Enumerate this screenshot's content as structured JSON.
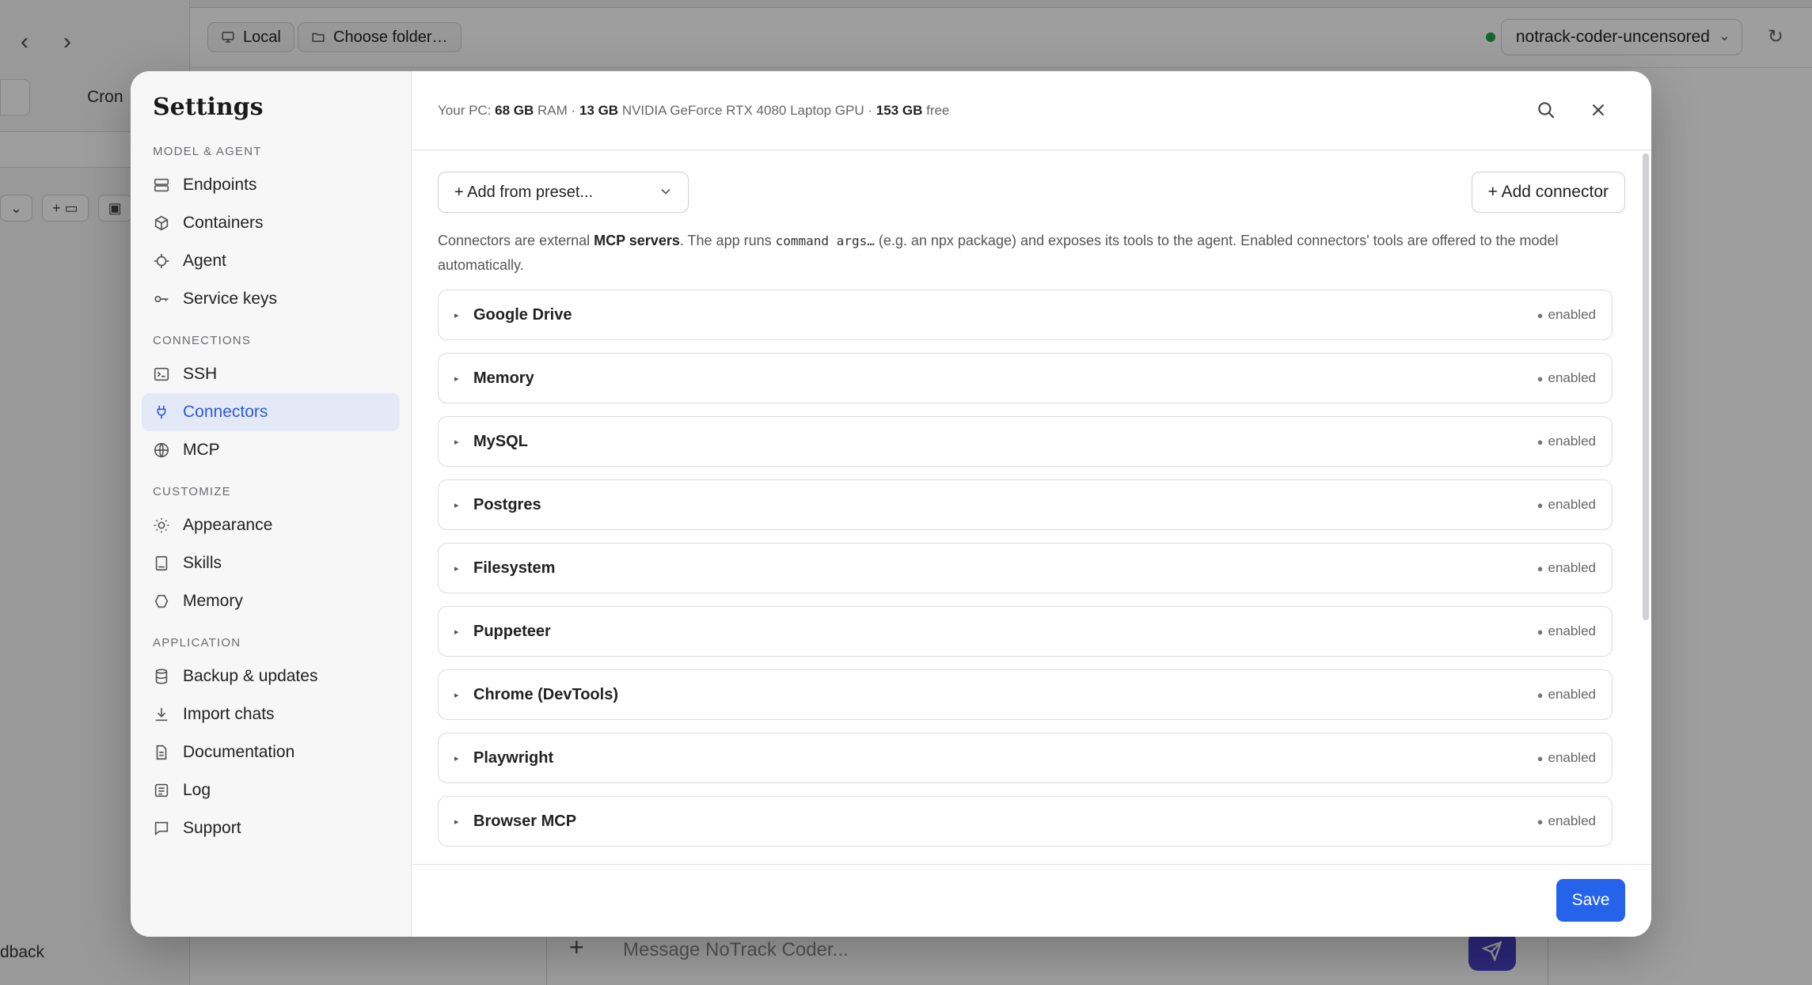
{
  "background": {
    "local_label": "Local",
    "folder_label": "Choose folder…",
    "model_name": "notrack-coder-uncensored",
    "cron_tab": "Cron",
    "feedback_text": "dback",
    "composer_placeholder": "Message NoTrack Coder...",
    "status_color": "#22a447"
  },
  "settings": {
    "title": "Settings",
    "sections": [
      {
        "label": "MODEL & AGENT",
        "items": [
          {
            "label": "Endpoints",
            "icon": "server-icon"
          },
          {
            "label": "Containers",
            "icon": "box-icon"
          },
          {
            "label": "Agent",
            "icon": "chip-icon"
          },
          {
            "label": "Service keys",
            "icon": "key-icon"
          }
        ]
      },
      {
        "label": "CONNECTIONS",
        "items": [
          {
            "label": "SSH",
            "icon": "terminal-icon"
          },
          {
            "label": "Connectors",
            "icon": "plug-icon",
            "active": true
          },
          {
            "label": "MCP",
            "icon": "globe-icon"
          }
        ]
      },
      {
        "label": "CUSTOMIZE",
        "items": [
          {
            "label": "Appearance",
            "icon": "sun-icon"
          },
          {
            "label": "Skills",
            "icon": "book-icon"
          },
          {
            "label": "Memory",
            "icon": "memory-icon"
          }
        ]
      },
      {
        "label": "APPLICATION",
        "items": [
          {
            "label": "Backup & updates",
            "icon": "database-icon"
          },
          {
            "label": "Import chats",
            "icon": "download-icon"
          },
          {
            "label": "Documentation",
            "icon": "document-icon"
          },
          {
            "label": "Log",
            "icon": "log-icon"
          },
          {
            "label": "Support",
            "icon": "chat-icon"
          }
        ]
      }
    ]
  },
  "header": {
    "prefix": "Your PC:",
    "ram_value": "68 GB",
    "ram_label": "RAM ·",
    "gpu_value": "13 GB",
    "gpu_label": "NVIDIA GeForce RTX 4080 Laptop GPU ·",
    "disk_value": "153 GB",
    "disk_label": "free"
  },
  "toolbar": {
    "preset_label": "+  Add from preset...",
    "add_connector_label": "+ Add connector"
  },
  "description": {
    "part1": "Connectors are external ",
    "bold": "MCP servers",
    "part2": ". The app runs ",
    "code": "command args…",
    "part3": " (e.g. an npx package) and exposes its tools to the agent. Enabled connectors' tools are offered to the model automatically."
  },
  "connectors": [
    {
      "name": "Google Drive",
      "status": "enabled"
    },
    {
      "name": "Memory",
      "status": "enabled"
    },
    {
      "name": "MySQL",
      "status": "enabled"
    },
    {
      "name": "Postgres",
      "status": "enabled"
    },
    {
      "name": "Filesystem",
      "status": "enabled"
    },
    {
      "name": "Puppeteer",
      "status": "enabled"
    },
    {
      "name": "Chrome (DevTools)",
      "status": "enabled"
    },
    {
      "name": "Playwright",
      "status": "enabled"
    },
    {
      "name": "Browser MCP",
      "status": "enabled"
    }
  ],
  "footer": {
    "save_label": "Save"
  }
}
